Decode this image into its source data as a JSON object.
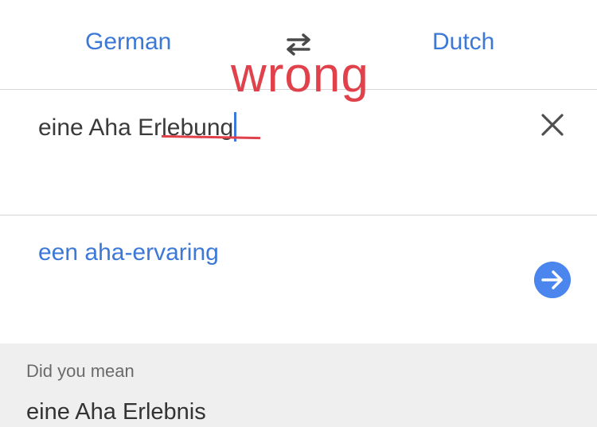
{
  "languages": {
    "source": "German",
    "target": "Dutch"
  },
  "icons": {
    "swap": "swap-arrows-icon",
    "clear": "close-icon",
    "go": "arrow-right-circle-icon"
  },
  "annotation": {
    "text": "wrong",
    "color": "#e0414a"
  },
  "input": {
    "text_before": "eine Aha E",
    "text_struck": "rlebung"
  },
  "output": {
    "translation": "een aha-ervaring"
  },
  "suggestion": {
    "label": "Did you mean",
    "text": "eine Aha Erlebnis"
  },
  "colors": {
    "accent": "#3b78d8",
    "button": "#4a86ee",
    "suggestion_bg": "#efefef"
  }
}
